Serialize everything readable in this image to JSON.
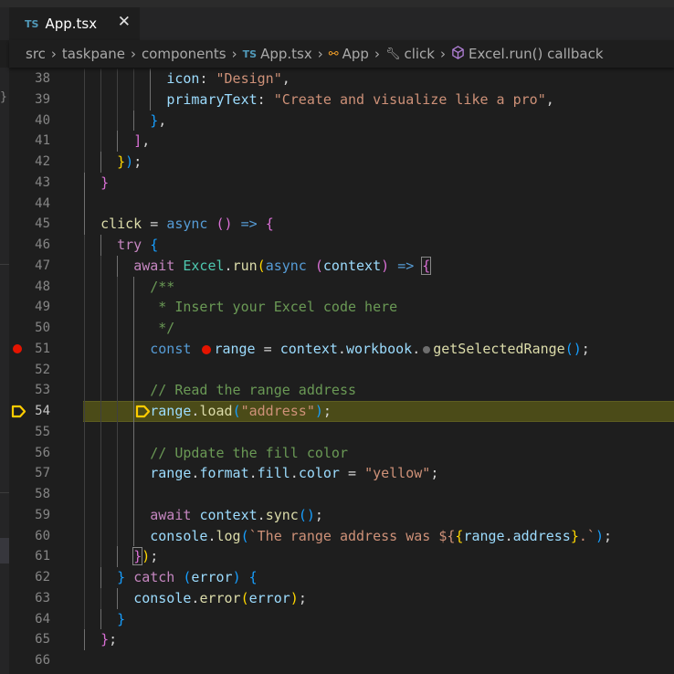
{
  "tab": {
    "lang_badge": "TS",
    "title": "App.tsx",
    "close_icon": "close-icon"
  },
  "breadcrumb": [
    {
      "label": "src"
    },
    {
      "label": "taskpane"
    },
    {
      "label": "components"
    },
    {
      "label": "App.tsx",
      "badge": "TS"
    },
    {
      "label": "App",
      "icon": "class-icon"
    },
    {
      "label": "click",
      "icon": "wrench-icon"
    },
    {
      "label": "Excel.run() callback",
      "icon": "cube-icon"
    }
  ],
  "left_panel_glyph": "}",
  "editor": {
    "breakpoint_line": 51,
    "current_line": 54,
    "colors": {
      "breakpoint": "#e51400",
      "current_line_bg": "#4b4b18",
      "debug_arrow": "#ffcc00"
    },
    "lines": [
      {
        "n": "38",
        "t": [
          [
            "          ",
            "ws"
          ],
          [
            "icon",
            "var"
          ],
          [
            ": ",
            "p"
          ],
          [
            "\"Design\"",
            "str"
          ],
          [
            ",",
            "p"
          ]
        ]
      },
      {
        "n": "39",
        "t": [
          [
            "          ",
            "ws"
          ],
          [
            "primaryText",
            "var"
          ],
          [
            ": ",
            "p"
          ],
          [
            "\"Create and visualize like a pro\"",
            "str"
          ],
          [
            ",",
            "p"
          ]
        ]
      },
      {
        "n": "40",
        "t": [
          [
            "        ",
            "ws"
          ],
          [
            "}",
            "b3"
          ],
          [
            ",",
            "p"
          ]
        ]
      },
      {
        "n": "41",
        "t": [
          [
            "      ",
            "ws"
          ],
          [
            "]",
            "b2"
          ],
          [
            ",",
            "p"
          ]
        ]
      },
      {
        "n": "42",
        "t": [
          [
            "    ",
            "ws"
          ],
          [
            "}",
            "b1"
          ],
          [
            ")",
            "b3"
          ],
          [
            ";",
            "p"
          ]
        ]
      },
      {
        "n": "43",
        "t": [
          [
            "  ",
            "ws"
          ],
          [
            "}",
            "b2"
          ]
        ]
      },
      {
        "n": "44",
        "t": []
      },
      {
        "n": "45",
        "t": [
          [
            "  ",
            "ws"
          ],
          [
            "click",
            "fn"
          ],
          [
            " = ",
            "p"
          ],
          [
            "async",
            "kw"
          ],
          [
            " ",
            "p"
          ],
          [
            "()",
            "b2"
          ],
          [
            " ",
            "p"
          ],
          [
            "=>",
            "kw"
          ],
          [
            " ",
            "p"
          ],
          [
            "{",
            "b2"
          ]
        ]
      },
      {
        "n": "46",
        "t": [
          [
            "    ",
            "ws"
          ],
          [
            "try",
            "ctrl"
          ],
          [
            " ",
            "p"
          ],
          [
            "{",
            "b3"
          ]
        ]
      },
      {
        "n": "47",
        "t": [
          [
            "      ",
            "ws"
          ],
          [
            "await",
            "ctrl"
          ],
          [
            " ",
            "p"
          ],
          [
            "Excel",
            "cls"
          ],
          [
            ".",
            "p"
          ],
          [
            "run",
            "fn"
          ],
          [
            "(",
            "b1"
          ],
          [
            "async",
            "kw"
          ],
          [
            " ",
            "p"
          ],
          [
            "(",
            "b2"
          ],
          [
            "context",
            "var"
          ],
          [
            ")",
            "b2"
          ],
          [
            " ",
            "p"
          ],
          [
            "=>",
            "kw"
          ],
          [
            " ",
            "p"
          ],
          [
            "{",
            "b2 boxed"
          ]
        ]
      },
      {
        "n": "48",
        "t": [
          [
            "        ",
            "ws"
          ],
          [
            "/**",
            "cmt"
          ]
        ]
      },
      {
        "n": "49",
        "t": [
          [
            "        ",
            "ws"
          ],
          [
            " * Insert your Excel code here",
            "cmt"
          ]
        ]
      },
      {
        "n": "50",
        "t": [
          [
            "        ",
            "ws"
          ],
          [
            " */",
            "cmt"
          ]
        ]
      },
      {
        "n": "51",
        "t": [
          [
            "        ",
            "ws"
          ],
          [
            "const",
            "kw"
          ],
          [
            " ",
            "p"
          ],
          [
            "",
            "bp"
          ],
          [
            "range",
            "var"
          ],
          [
            " = ",
            "p"
          ],
          [
            "context",
            "var"
          ],
          [
            ".",
            "p"
          ],
          [
            "workbook",
            "var"
          ],
          [
            ".",
            "p"
          ],
          [
            "",
            "bpg"
          ],
          [
            "getSelectedRange",
            "fn"
          ],
          [
            "()",
            "b3"
          ],
          [
            ";",
            "p"
          ]
        ]
      },
      {
        "n": "52",
        "t": []
      },
      {
        "n": "53",
        "t": [
          [
            "        ",
            "ws"
          ],
          [
            "// Read the range address",
            "cmt"
          ]
        ]
      },
      {
        "n": "54",
        "t": [
          [
            "        ",
            "ws"
          ],
          [
            "range",
            "var"
          ],
          [
            ".",
            "p"
          ],
          [
            "load",
            "fn"
          ],
          [
            "(",
            "b3"
          ],
          [
            "\"address\"",
            "str"
          ],
          [
            ")",
            "b3"
          ],
          [
            ";",
            "p"
          ]
        ]
      },
      {
        "n": "55",
        "t": []
      },
      {
        "n": "56",
        "t": [
          [
            "        ",
            "ws"
          ],
          [
            "// Update the fill color",
            "cmt"
          ]
        ]
      },
      {
        "n": "57",
        "t": [
          [
            "        ",
            "ws"
          ],
          [
            "range",
            "var"
          ],
          [
            ".",
            "p"
          ],
          [
            "format",
            "var"
          ],
          [
            ".",
            "p"
          ],
          [
            "fill",
            "var"
          ],
          [
            ".",
            "p"
          ],
          [
            "color",
            "var"
          ],
          [
            " = ",
            "p"
          ],
          [
            "\"yellow\"",
            "str"
          ],
          [
            ";",
            "p"
          ]
        ]
      },
      {
        "n": "58",
        "t": []
      },
      {
        "n": "59",
        "t": [
          [
            "        ",
            "ws"
          ],
          [
            "await",
            "ctrl"
          ],
          [
            " ",
            "p"
          ],
          [
            "context",
            "var"
          ],
          [
            ".",
            "p"
          ],
          [
            "sync",
            "fn"
          ],
          [
            "()",
            "b3"
          ],
          [
            ";",
            "p"
          ]
        ]
      },
      {
        "n": "60",
        "t": [
          [
            "        ",
            "ws"
          ],
          [
            "console",
            "var"
          ],
          [
            ".",
            "p"
          ],
          [
            "log",
            "fn"
          ],
          [
            "(",
            "b3"
          ],
          [
            "`The range address was ${",
            "str"
          ],
          [
            "{",
            "b1"
          ],
          [
            "range",
            "var"
          ],
          [
            ".",
            "p"
          ],
          [
            "address",
            "var"
          ],
          [
            "}",
            "b1"
          ],
          [
            ".`",
            "str"
          ],
          [
            ")",
            "b3"
          ],
          [
            ";",
            "p"
          ]
        ]
      },
      {
        "n": "61",
        "t": [
          [
            "      ",
            "ws"
          ],
          [
            "}",
            "b2 boxed"
          ],
          [
            ")",
            "b1"
          ],
          [
            ";",
            "p"
          ]
        ]
      },
      {
        "n": "62",
        "t": [
          [
            "    ",
            "ws"
          ],
          [
            "}",
            "b3"
          ],
          [
            " ",
            "p"
          ],
          [
            "catch",
            "ctrl"
          ],
          [
            " ",
            "p"
          ],
          [
            "(",
            "b3"
          ],
          [
            "error",
            "var"
          ],
          [
            ")",
            "b3"
          ],
          [
            " ",
            "p"
          ],
          [
            "{",
            "b3"
          ]
        ]
      },
      {
        "n": "63",
        "t": [
          [
            "      ",
            "ws"
          ],
          [
            "console",
            "var"
          ],
          [
            ".",
            "p"
          ],
          [
            "error",
            "fn"
          ],
          [
            "(",
            "b1"
          ],
          [
            "error",
            "var"
          ],
          [
            ")",
            "b1"
          ],
          [
            ";",
            "p"
          ]
        ]
      },
      {
        "n": "64",
        "t": [
          [
            "    ",
            "ws"
          ],
          [
            "}",
            "b3"
          ]
        ]
      },
      {
        "n": "65",
        "t": [
          [
            "  ",
            "ws"
          ],
          [
            "}",
            "b2"
          ],
          [
            ";",
            "p"
          ]
        ]
      },
      {
        "n": "66",
        "t": []
      }
    ]
  }
}
